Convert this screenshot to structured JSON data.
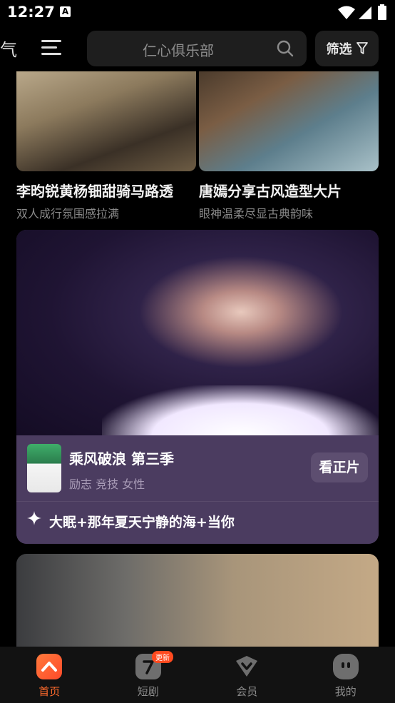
{
  "status_bar": {
    "time": "12:27",
    "notification": "A"
  },
  "top_bar": {
    "weather_fragment": "气",
    "search_placeholder": "仁心俱乐部",
    "filter_label": "筛选"
  },
  "cards": [
    {
      "title": "李昀锐黄杨钿甜骑马路透",
      "subtitle": "双人成行氛围感拉满"
    },
    {
      "title": "唐嫣分享古风造型大片",
      "subtitle": "眼神温柔尽显古典韵味"
    }
  ],
  "feature": {
    "show_title": "乘风破浪 第三季",
    "tags": "励志 竞技 女性",
    "watch_label": "看正片",
    "caption": "大眠+那年夏天宁静的海+当你"
  },
  "bottom_nav": [
    {
      "label": "首页",
      "active": true
    },
    {
      "label": "短剧",
      "active": false,
      "badge": "更新"
    },
    {
      "label": "会员",
      "active": false
    },
    {
      "label": "我的",
      "active": false
    }
  ],
  "colors": {
    "accent": "#ff6a2c",
    "feature_bg": "#4b3c60",
    "badge": "#ff4a1f"
  }
}
